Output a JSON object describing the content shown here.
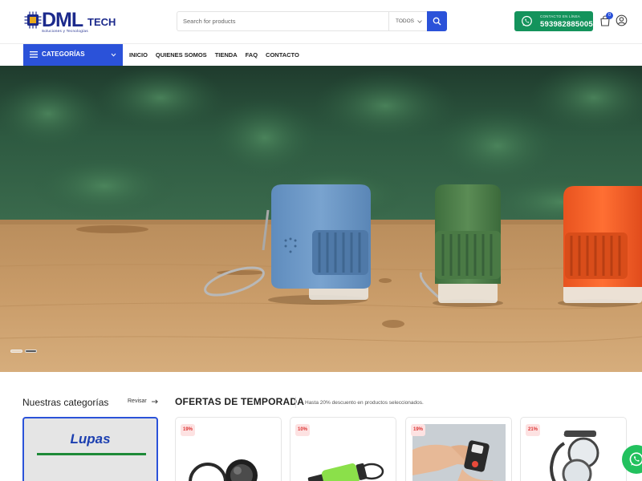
{
  "brand": {
    "name": "DML",
    "suffix": "TECH",
    "tagline": "Soluciones y Tecnologías"
  },
  "search": {
    "placeholder": "Search for products",
    "category": "TODOS"
  },
  "contact": {
    "label": "CONTACTO EN LÍNEA",
    "phone": "593982885005"
  },
  "cart": {
    "count": "0"
  },
  "nav": {
    "categories_label": "CATEGORÍAS",
    "links": [
      "INICIO",
      "QUIENES SOMOS",
      "TIENDA",
      "FAQ",
      "CONTACTO"
    ]
  },
  "hero": {
    "slide_count": 2,
    "active_slide": 2
  },
  "categories_section": {
    "title": "Nuestras categorías",
    "link": "Revisar",
    "card": {
      "name": "Lupas"
    }
  },
  "offers": {
    "title": "OFERTAS DE TEMPORADA",
    "subtitle": "Hasta 20% descuento en productos seleccionados.",
    "products": [
      {
        "discount": "19%",
        "icon": "folding-magnifier"
      },
      {
        "discount": "10%",
        "icon": "flashlight-keychain"
      },
      {
        "discount": "19%",
        "icon": "pocket-magnifier-in-hand"
      },
      {
        "discount": "21%",
        "icon": "neck-magnifier"
      }
    ]
  },
  "colors": {
    "primary": "#2b52d9",
    "whatsapp": "#14935c",
    "whatsapp_float": "#22c15e",
    "discount": "#d33333"
  }
}
